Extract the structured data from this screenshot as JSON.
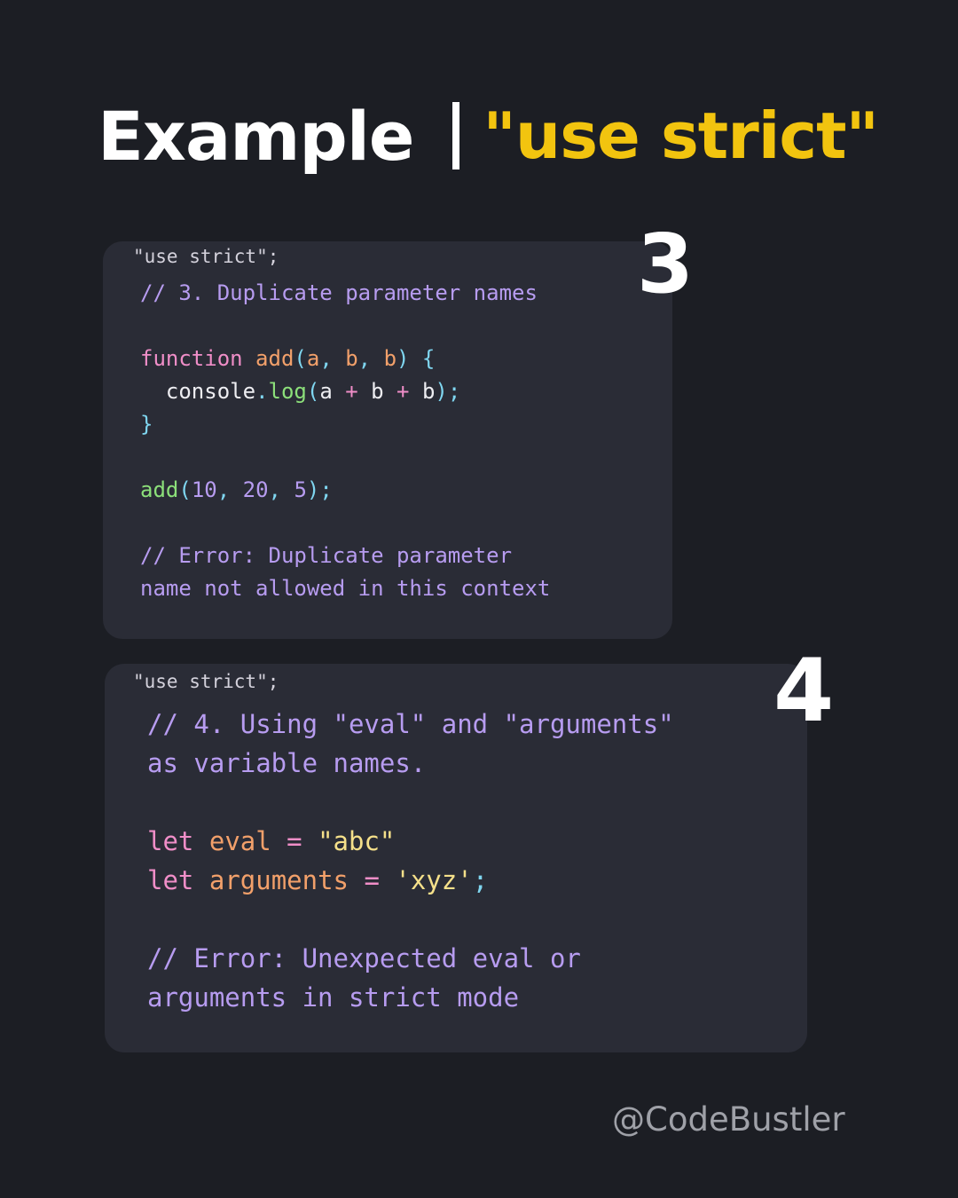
{
  "header": {
    "title": "Example",
    "accent": "\"use strict\""
  },
  "card1": {
    "number": "3",
    "directive": "\"use strict\";",
    "comment": "// 3. Duplicate parameter names",
    "func_kw": "function",
    "func_name": "add",
    "func_open": "(",
    "p_a": "a",
    "comma": ", ",
    "p_b": "b",
    "p_b2": "b",
    "func_close": ") {",
    "indent": "  ",
    "console": "console",
    "dot": ".",
    "log": "log",
    "log_open": "(",
    "a": "a",
    "plus": " + ",
    "b": "b",
    "b2": "b",
    "log_close": ");",
    "brace_close": "}",
    "call_name": "add",
    "call_open": "(",
    "arg1": "10",
    "arg2": "20",
    "arg3": "5",
    "call_close": ");",
    "error_line1": "// Error: Duplicate parameter",
    "error_line2": "name not allowed in this context"
  },
  "card2": {
    "number": "4",
    "directive": "\"use strict\";",
    "comment_line1": "// 4. Using \"eval\" and \"arguments\"",
    "comment_line2": "as variable names.",
    "let1": "let",
    "var1": "eval",
    "eq": " = ",
    "val1": "\"abc\"",
    "let2": "let",
    "var2": "arguments",
    "val2": "'xyz'",
    "semi": ";",
    "error_line1": "// Error: Unexpected eval or",
    "error_line2": "arguments in strict mode"
  },
  "footer": {
    "handle": "@CodeBustler"
  }
}
